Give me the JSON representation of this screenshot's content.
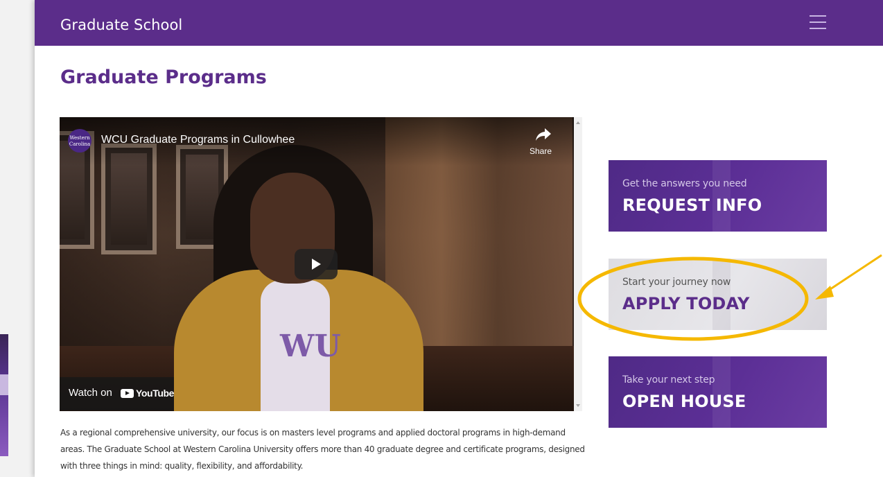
{
  "header": {
    "site_title": "Graduate School",
    "menu_icon": "hamburger-menu-icon"
  },
  "main": {
    "page_title": "Graduate Programs",
    "video": {
      "title": "WCU Graduate Programs in Cullowhee",
      "channel_logo_text": "Western Carolina",
      "share_label": "Share",
      "watch_on_label": "Watch on",
      "youtube_label": "YouTube",
      "shirt_text": "WU"
    },
    "description": "As a regional comprehensive university, our focus is on masters level programs and applied doctoral programs in high-demand areas. The Graduate School at Western Carolina University offers more than 40 graduate degree and certificate programs, designed with three things in mind: quality, flexibility, and affordability."
  },
  "cta": [
    {
      "subtitle": "Get the answers you need",
      "label": "REQUEST INFO"
    },
    {
      "subtitle": "Start your journey now",
      "label": "APPLY TODAY"
    },
    {
      "subtitle": "Take your next step",
      "label": "OPEN HOUSE"
    }
  ],
  "colors": {
    "brand_purple": "#5b2d8a",
    "highlight_gold": "#f5b800"
  }
}
